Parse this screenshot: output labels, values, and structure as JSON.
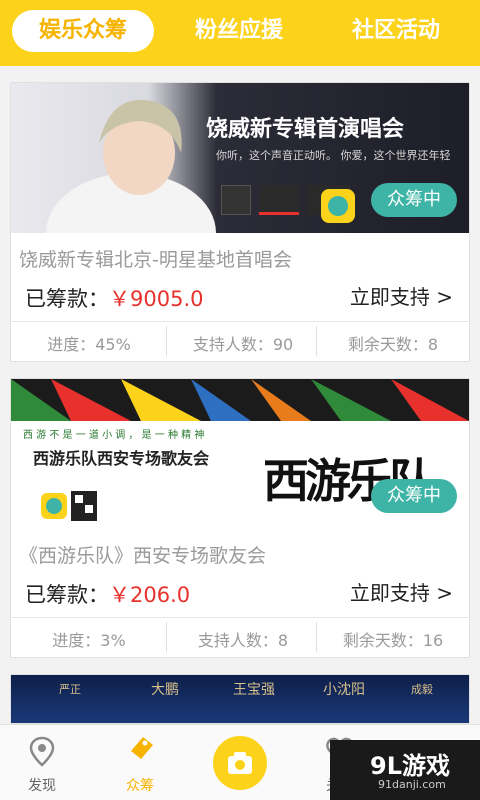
{
  "tabs": [
    {
      "label": "娱乐众筹"
    },
    {
      "label": "粉丝应援"
    },
    {
      "label": "社区活动"
    }
  ],
  "cards": [
    {
      "banner_headline": "饶威新专辑首演唱会",
      "banner_subline": "你听，这个声音正动听。  你爱，这个世界还年轻",
      "status_badge": "众筹中",
      "title": "饶威新专辑北京-明星基地首唱会",
      "raised_label": "已筹款：",
      "raised_amount": "￥9005.0",
      "support_label": "立即支持 >",
      "progress": "进度：45%",
      "supporters": "支持人数：90",
      "days_left": "剩余天数：8"
    },
    {
      "banner_headline": "西游乐队西安专场歌友会",
      "banner_motto": "西  游  不  是  一  道  小  调  ，  是  一  种  精  神",
      "banner_calligraphy": "西游乐队",
      "status_badge": "众筹中",
      "title": "《西游乐队》西安专场歌友会",
      "raised_label": "已筹款：",
      "raised_amount": "￥206.0",
      "support_label": "立即支持 >",
      "progress": "进度：3%",
      "supporters": "支持人数：8",
      "days_left": "剩余天数：16"
    }
  ],
  "third_card_names": [
    "严正",
    "大鹏",
    "王宝强",
    "小沈阳",
    "成毅"
  ],
  "bottom_nav": [
    {
      "label": "发现"
    },
    {
      "label": "众筹"
    },
    {
      "label": "关注"
    }
  ],
  "watermark": {
    "brand": "9L游戏",
    "site": "91danji.com"
  },
  "colors": {
    "accent": "#fcd21a",
    "active_text": "#f6b400",
    "price": "#e8312c",
    "badge": "#3db4a6"
  }
}
